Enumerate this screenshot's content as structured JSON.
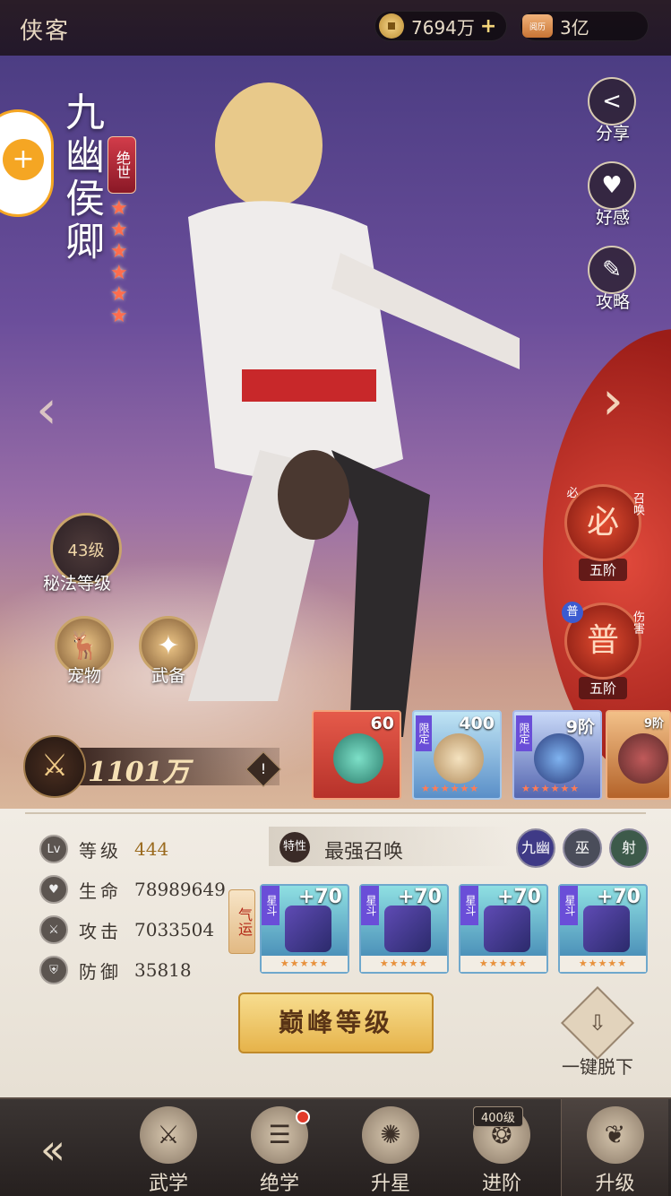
{
  "header": {
    "title": "侠客",
    "coins": "7694万",
    "coin_plus": "+",
    "jade": "3亿",
    "jade_icon_text": "阅历"
  },
  "hero": {
    "name": "九幽侯卿",
    "rarity": "绝世",
    "stars": 6,
    "power": "1101万"
  },
  "side_buttons": [
    {
      "label": "分享",
      "icon": "share-icon"
    },
    {
      "label": "好感",
      "icon": "heart-icon"
    },
    {
      "label": "攻略",
      "icon": "guide-icon"
    }
  ],
  "skills": [
    {
      "tag": "必",
      "type": "召唤",
      "tier": "五阶",
      "glyph": "必"
    },
    {
      "tag": "普",
      "type": "伤害",
      "tier": "五阶",
      "glyph": "普"
    }
  ],
  "secret_art": {
    "level": "43级",
    "label": "秘法等级"
  },
  "pet": {
    "label": "宠物"
  },
  "weapon": {
    "label": "武备"
  },
  "treasures": [
    {
      "value": "60",
      "limited": ""
    },
    {
      "value": "400",
      "limited": "限定"
    },
    {
      "value": "9阶",
      "limited": "限定"
    },
    {
      "value": "9阶",
      "limited": ""
    }
  ],
  "stats": [
    {
      "icon": "Lv",
      "label": "等级",
      "value": "444"
    },
    {
      "icon": "♥",
      "label": "生命",
      "value": "78989649"
    },
    {
      "icon": "⚔",
      "label": "攻击",
      "value": "7033504"
    },
    {
      "icon": "⛨",
      "label": "防御",
      "value": "35818"
    }
  ],
  "summon": {
    "badge": "特性",
    "title": "最强召唤",
    "sets": [
      "九幽",
      "巫",
      "射"
    ]
  },
  "fate_tag": "气运",
  "equipment": [
    {
      "tag": "星斗",
      "level": "+70"
    },
    {
      "tag": "星斗",
      "level": "+70"
    },
    {
      "tag": "星斗",
      "level": "+70"
    },
    {
      "tag": "星斗",
      "level": "+70"
    }
  ],
  "peak_button": "巅峰等级",
  "unequip_label": "一键脱下",
  "nav": {
    "items": [
      {
        "label": "武学",
        "badge": ""
      },
      {
        "label": "绝学",
        "badge": ""
      },
      {
        "label": "升星",
        "badge": ""
      },
      {
        "label": "进阶",
        "badge": "400级"
      },
      {
        "label": "升级",
        "badge": ""
      }
    ]
  },
  "colors": {
    "accent_gold": "#e6b34a",
    "rarity_red": "#d23c4a",
    "panel_bg": "#f1ece4"
  }
}
